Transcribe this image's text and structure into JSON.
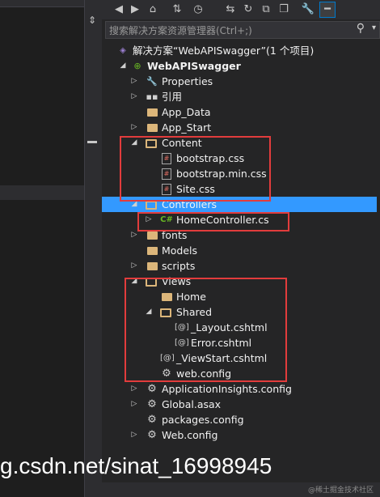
{
  "toolbar": {
    "icons": [
      "back-icon",
      "forward-icon",
      "home-icon",
      "sync-icon",
      "history-icon",
      "collapse-icon",
      "refresh-icon",
      "pending-icon",
      "copy-icon",
      "properties-icon",
      "preview-icon"
    ]
  },
  "search": {
    "placeholder": "搜索解决方案资源管理器(Ctrl+;)"
  },
  "tree": {
    "solution": "解决方案“WebAPISwagger”(1 个项目)",
    "project": "WebAPISwagger",
    "properties": "Properties",
    "references": "引用",
    "app_data": "App_Data",
    "app_start": "App_Start",
    "content": "Content",
    "bootstrap_css": "bootstrap.css",
    "bootstrap_min_css": "bootstrap.min.css",
    "site_css": "Site.css",
    "controllers": "Controllers",
    "home_controller": "HomeController.cs",
    "fonts": "fonts",
    "models": "Models",
    "scripts": "scripts",
    "views": "Views",
    "views_home": "Home",
    "views_shared": "Shared",
    "layout_cshtml": "_Layout.cshtml",
    "error_cshtml": "Error.cshtml",
    "viewstart_cshtml": "_ViewStart.cshtml",
    "views_webconfig": "web.config",
    "app_insights": "ApplicationInsights.config",
    "global_asax": "Global.asax",
    "packages_config": "packages.config",
    "web_config": "Web.config"
  },
  "overlay": {
    "watermark": "g.csdn.net/sinat_16998945",
    "credit": "@稀土掘金技术社区"
  },
  "colors": {
    "selection": "#3399ff",
    "highlight_box": "#e23c3c",
    "folder": "#dcb67a"
  }
}
